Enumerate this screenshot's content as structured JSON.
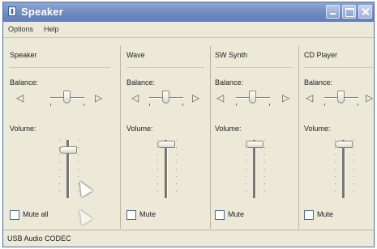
{
  "window": {
    "title": "Speaker",
    "menu": [
      "Options",
      "Help"
    ],
    "status": "USB Audio CODEC"
  },
  "channels": [
    {
      "name": "Speaker",
      "balance_label": "Balance:",
      "volume_label": "Volume:",
      "mute_label": "Mute all",
      "balance_level": 0.5,
      "volume_level": 0.85
    },
    {
      "name": "Wave",
      "balance_label": "Balance:",
      "volume_label": "Volume:",
      "mute_label": "Mute",
      "balance_level": 0.5,
      "volume_level": 0.9
    },
    {
      "name": "SW Synth",
      "balance_label": "Balance:",
      "volume_label": "Volume:",
      "mute_label": "Mute",
      "balance_level": 0.5,
      "volume_level": 0.9
    },
    {
      "name": "CD Player",
      "balance_label": "Balance:",
      "volume_label": "Volume:",
      "mute_label": "Mute",
      "balance_level": 0.5,
      "volume_level": 0.9
    }
  ],
  "icons": {
    "left_speaker": "speaker-left-icon",
    "right_speaker": "speaker-right-icon",
    "cursor": "mouse-cursor-icon"
  }
}
